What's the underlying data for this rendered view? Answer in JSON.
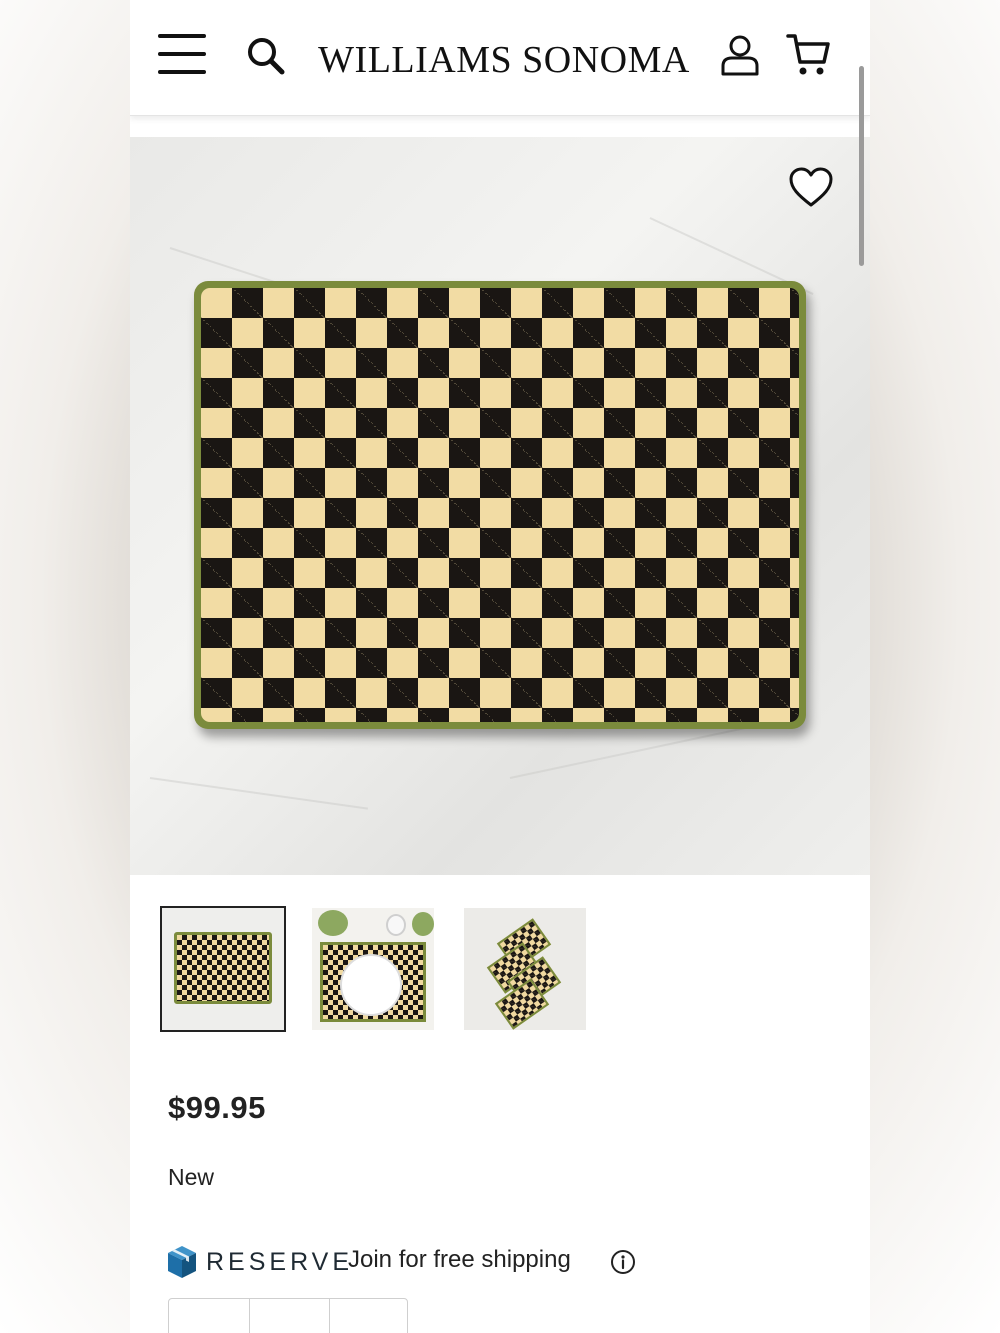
{
  "header": {
    "brand": "WILLIAMS SONOMA",
    "icons": [
      "menu-icon",
      "search-icon",
      "user-icon",
      "cart-icon"
    ]
  },
  "hero": {
    "wishlist_icon": "heart-icon",
    "product_visual": "checkered placemat with green border"
  },
  "thumbnails": [
    {
      "name": "thumb-placemat-flat",
      "selected": true
    },
    {
      "name": "thumb-table-setting",
      "selected": false
    },
    {
      "name": "thumb-placemat-set",
      "selected": false
    }
  ],
  "product": {
    "price": "$99.95",
    "badge": "New"
  },
  "reserve": {
    "logo_word": "RESERVE",
    "text": "Join for free shipping",
    "info_icon": "info-icon"
  },
  "colors": {
    "accent_blue": "#1e6fa8",
    "check_dark": "#1a1613",
    "check_light": "#f2dca4",
    "border_green": "#7b8b3c"
  }
}
